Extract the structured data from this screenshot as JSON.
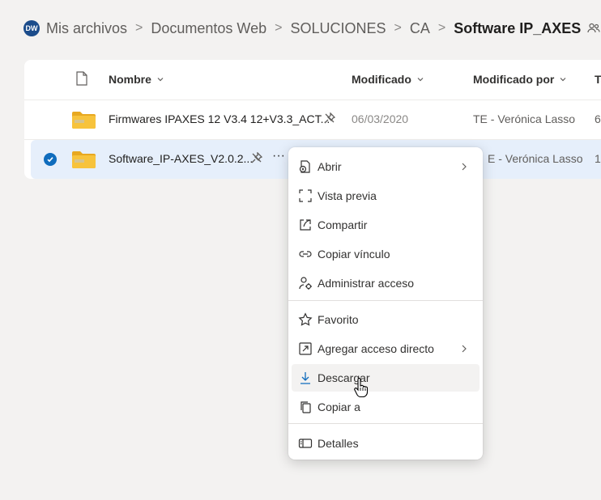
{
  "breadcrumb": {
    "site_initials": "DW",
    "items": [
      "Mis archivos",
      "Documentos Web",
      "SOLUCIONES",
      "CA"
    ],
    "current": "Software IP_AXES",
    "separator": ">"
  },
  "columns": {
    "name": "Nombre",
    "modified": "Modificado",
    "modified_by": "Modificado por",
    "size_partial": "Ta"
  },
  "rows": [
    {
      "name": "Firmwares IPAXES 12 V3.4 12+V3.3_ACT...",
      "modified": "06/03/2020",
      "modified_by": "TE - Verónica Lasso",
      "size_partial": "6",
      "selected": false
    },
    {
      "name": "Software_IP-AXES_V2.0.2...",
      "more": "···",
      "modified_by_partial": "E - Verónica Lasso",
      "size_partial": "1",
      "selected": true
    }
  ],
  "context_menu": {
    "items": [
      {
        "label": "Abrir",
        "icon": "open-icon",
        "submenu": true
      },
      {
        "label": "Vista previa",
        "icon": "preview-icon"
      },
      {
        "label": "Compartir",
        "icon": "share-icon"
      },
      {
        "label": "Copiar vínculo",
        "icon": "link-icon"
      },
      {
        "label": "Administrar acceso",
        "icon": "manage-access-icon"
      },
      {
        "label": "Favorito",
        "icon": "star-icon"
      },
      {
        "label": "Agregar acceso directo",
        "icon": "shortcut-icon",
        "submenu": true
      },
      {
        "label": "Descargar",
        "icon": "download-icon",
        "hovered": true
      },
      {
        "label": "Copiar a",
        "icon": "copy-icon"
      },
      {
        "label": "Detalles",
        "icon": "details-icon"
      }
    ]
  },
  "colors": {
    "accent": "#0f6cbd",
    "selected_row": "#e6effb",
    "folder": "#f7c33c",
    "background": "#f3f2f1"
  }
}
